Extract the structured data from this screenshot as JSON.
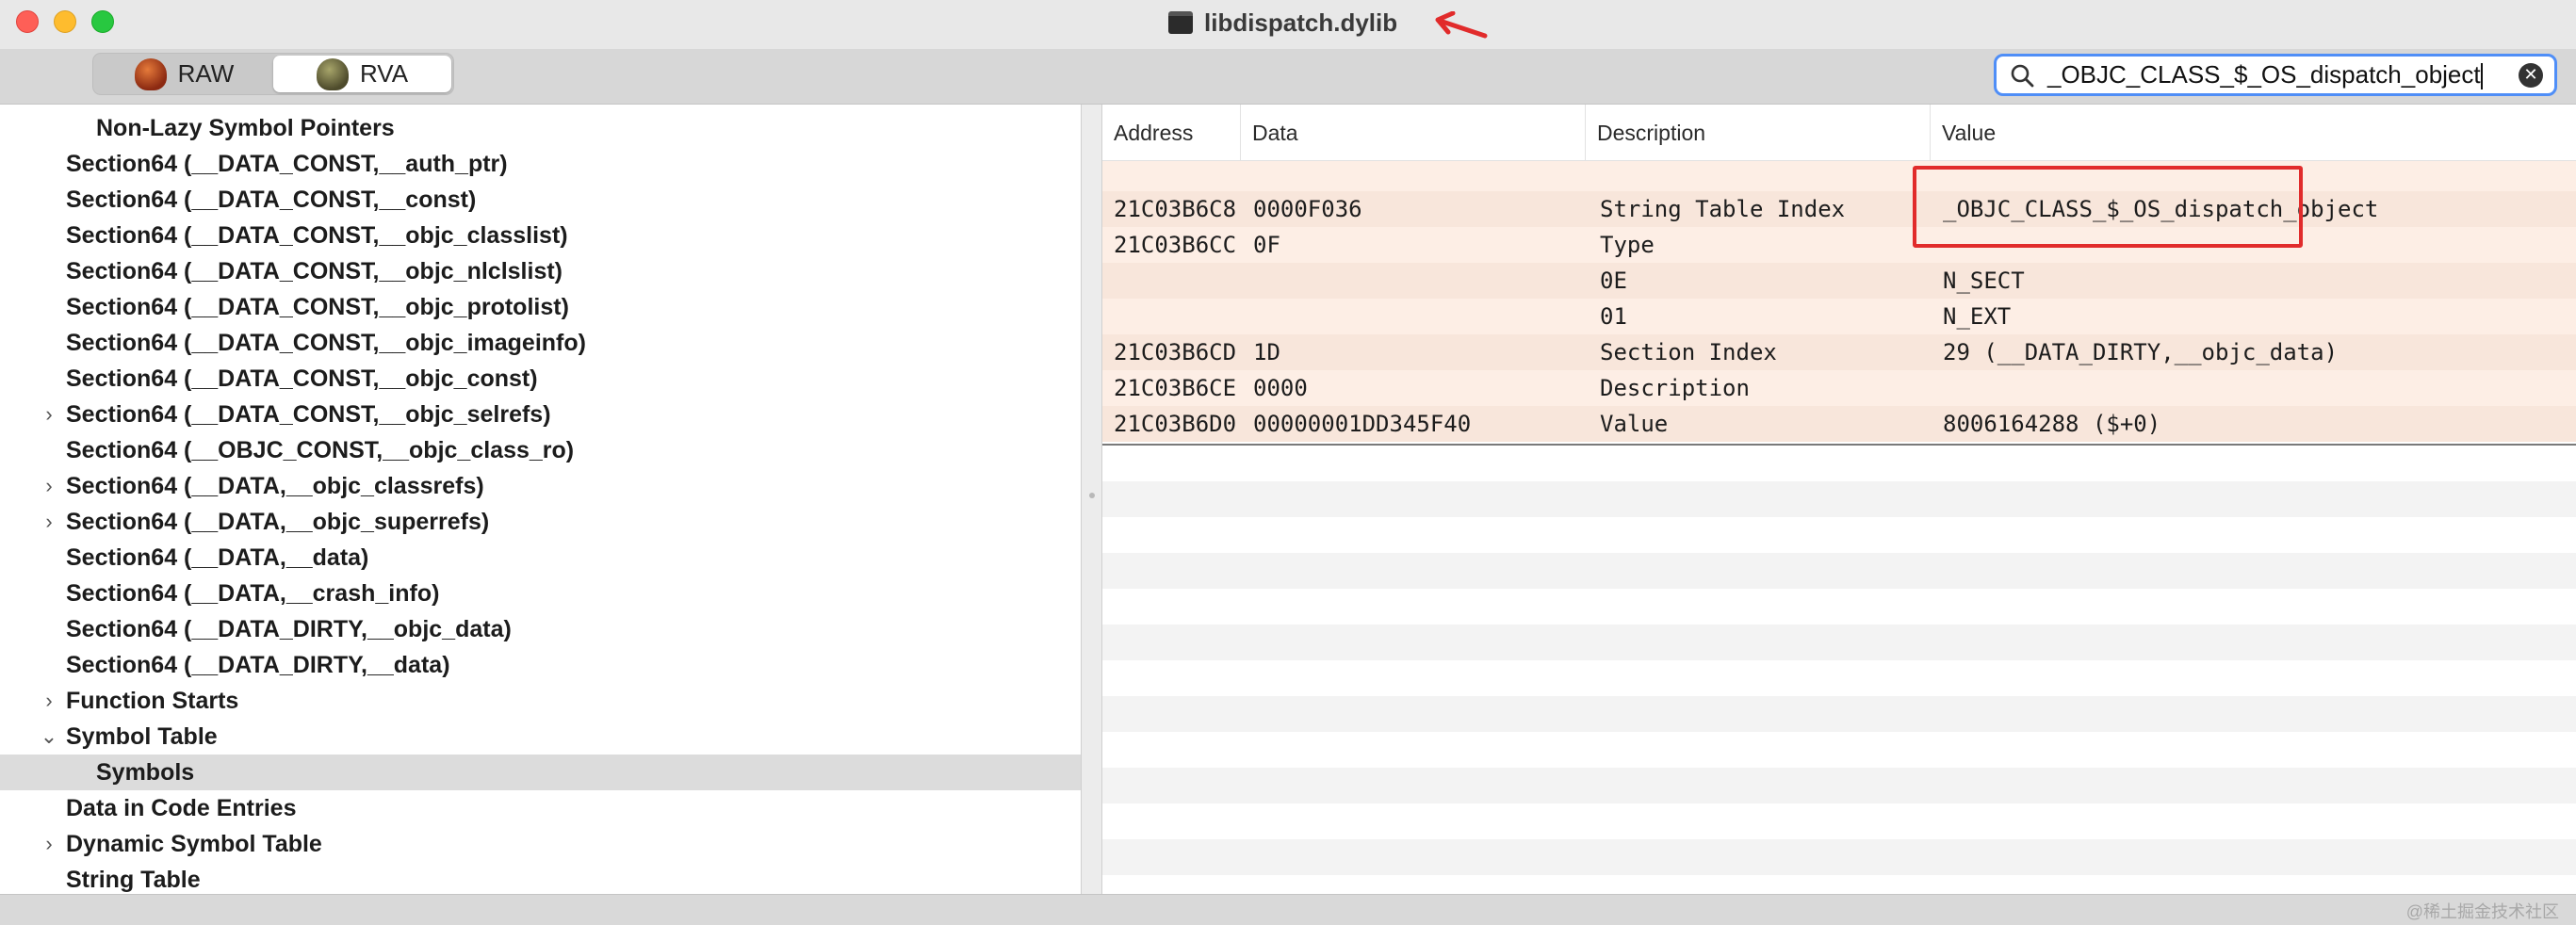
{
  "window": {
    "title": "libdispatch.dylib"
  },
  "toolbar": {
    "modes": [
      {
        "label": "RAW",
        "icon": "raw-beetle-icon",
        "active": false
      },
      {
        "label": "RVA",
        "icon": "rva-beetle-icon",
        "active": true
      }
    ]
  },
  "search": {
    "value": "_OBJC_CLASS_$_OS_dispatch_object"
  },
  "sidebar": {
    "items": [
      {
        "label": "Non-Lazy Symbol Pointers",
        "level": 2,
        "disclosure": "none",
        "selected": false
      },
      {
        "label": "Section64 (__DATA_CONST,__auth_ptr)",
        "level": 1,
        "disclosure": "none",
        "selected": false
      },
      {
        "label": "Section64 (__DATA_CONST,__const)",
        "level": 1,
        "disclosure": "none",
        "selected": false
      },
      {
        "label": "Section64 (__DATA_CONST,__objc_classlist)",
        "level": 1,
        "disclosure": "none",
        "selected": false
      },
      {
        "label": "Section64 (__DATA_CONST,__objc_nlclslist)",
        "level": 1,
        "disclosure": "none",
        "selected": false
      },
      {
        "label": "Section64 (__DATA_CONST,__objc_protolist)",
        "level": 1,
        "disclosure": "none",
        "selected": false
      },
      {
        "label": "Section64 (__DATA_CONST,__objc_imageinfo)",
        "level": 1,
        "disclosure": "none",
        "selected": false
      },
      {
        "label": "Section64 (__DATA_CONST,__objc_const)",
        "level": 1,
        "disclosure": "none",
        "selected": false
      },
      {
        "label": "Section64 (__DATA_CONST,__objc_selrefs)",
        "level": 1,
        "disclosure": "collapsed",
        "selected": false
      },
      {
        "label": "Section64 (__OBJC_CONST,__objc_class_ro)",
        "level": 1,
        "disclosure": "none",
        "selected": false
      },
      {
        "label": "Section64 (__DATA,__objc_classrefs)",
        "level": 1,
        "disclosure": "collapsed",
        "selected": false
      },
      {
        "label": "Section64 (__DATA,__objc_superrefs)",
        "level": 1,
        "disclosure": "collapsed",
        "selected": false
      },
      {
        "label": "Section64 (__DATA,__data)",
        "level": 1,
        "disclosure": "none",
        "selected": false
      },
      {
        "label": "Section64 (__DATA,__crash_info)",
        "level": 1,
        "disclosure": "none",
        "selected": false
      },
      {
        "label": "Section64 (__DATA_DIRTY,__objc_data)",
        "level": 1,
        "disclosure": "none",
        "selected": false
      },
      {
        "label": "Section64 (__DATA_DIRTY,__data)",
        "level": 1,
        "disclosure": "none",
        "selected": false
      },
      {
        "label": "Function Starts",
        "level": 1,
        "disclosure": "collapsed",
        "selected": false
      },
      {
        "label": "Symbol Table",
        "level": 1,
        "disclosure": "expanded",
        "selected": false
      },
      {
        "label": "Symbols",
        "level": 2,
        "disclosure": "none",
        "selected": true
      },
      {
        "label": "Data in Code Entries",
        "level": 1,
        "disclosure": "none",
        "selected": false
      },
      {
        "label": "Dynamic Symbol Table",
        "level": 1,
        "disclosure": "collapsed",
        "selected": false
      },
      {
        "label": "String Table",
        "level": 1,
        "disclosure": "none",
        "selected": false
      }
    ]
  },
  "table": {
    "columns": [
      "Address",
      "Data",
      "Description",
      "Value"
    ],
    "rows": [
      {
        "address": "",
        "data": "",
        "description": "",
        "value": ""
      },
      {
        "address": "21C03B6C8",
        "data": "0000F036",
        "description": "String Table Index",
        "value": "_OBJC_CLASS_$_OS_dispatch_object"
      },
      {
        "address": "21C03B6CC",
        "data": "0F",
        "description": "Type",
        "value": ""
      },
      {
        "address": "",
        "data": "",
        "description": "0E",
        "value": "N_SECT"
      },
      {
        "address": "",
        "data": "",
        "description": "01",
        "value": "N_EXT"
      },
      {
        "address": "21C03B6CD",
        "data": "1D",
        "description": "Section Index",
        "value": "29 (__DATA_DIRTY,__objc_data)"
      },
      {
        "address": "21C03B6CE",
        "data": "0000",
        "description": "Description",
        "value": ""
      },
      {
        "address": "21C03B6D0",
        "data": "00000001DD345F40",
        "description": "Value",
        "value": "8006164288 ($+0)"
      }
    ]
  },
  "statusbar": {
    "watermark": "@稀土掘金技术社区"
  },
  "colors": {
    "annotation_red": "#e12b2b",
    "row_highlight": "#fdeee5",
    "search_focus": "#4f8ef7"
  }
}
